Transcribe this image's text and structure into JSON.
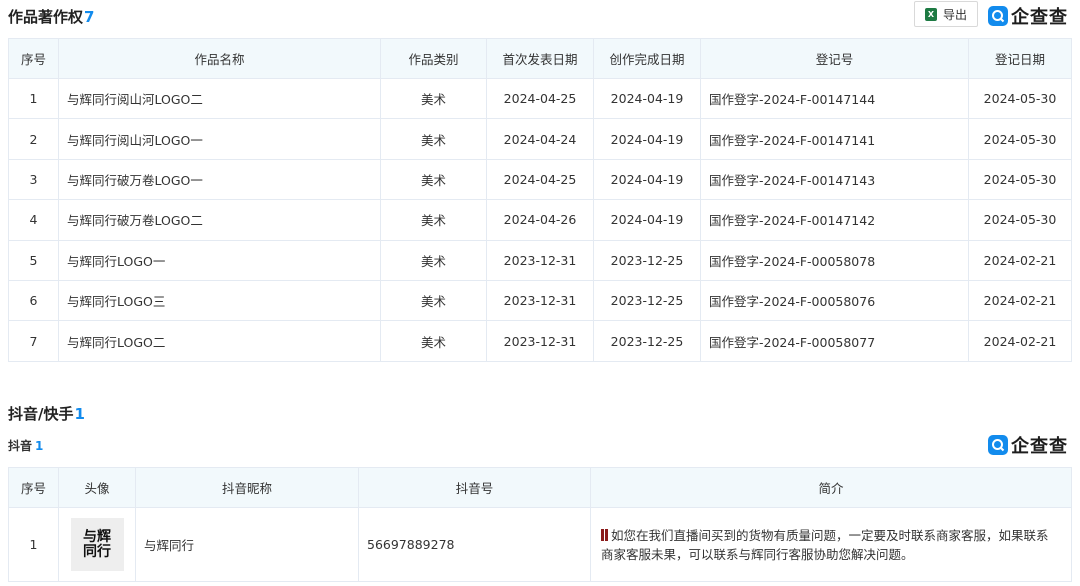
{
  "copyright": {
    "title": "作品著作权",
    "count": "7",
    "export_label": "导出",
    "brand": "企查查",
    "columns": [
      "序号",
      "作品名称",
      "作品类别",
      "首次发表日期",
      "创作完成日期",
      "登记号",
      "登记日期"
    ],
    "rows": [
      [
        "1",
        "与辉同行阅山河LOGO二",
        "美术",
        "2024-04-25",
        "2024-04-19",
        "国作登字-2024-F-00147144",
        "2024-05-30"
      ],
      [
        "2",
        "与辉同行阅山河LOGO一",
        "美术",
        "2024-04-24",
        "2024-04-19",
        "国作登字-2024-F-00147141",
        "2024-05-30"
      ],
      [
        "3",
        "与辉同行破万卷LOGO一",
        "美术",
        "2024-04-25",
        "2024-04-19",
        "国作登字-2024-F-00147143",
        "2024-05-30"
      ],
      [
        "4",
        "与辉同行破万卷LOGO二",
        "美术",
        "2024-04-26",
        "2024-04-19",
        "国作登字-2024-F-00147142",
        "2024-05-30"
      ],
      [
        "5",
        "与辉同行LOGO一",
        "美术",
        "2023-12-31",
        "2023-12-25",
        "国作登字-2024-F-00058078",
        "2024-02-21"
      ],
      [
        "6",
        "与辉同行LOGO三",
        "美术",
        "2023-12-31",
        "2023-12-25",
        "国作登字-2024-F-00058076",
        "2024-02-21"
      ],
      [
        "7",
        "与辉同行LOGO二",
        "美术",
        "2023-12-31",
        "2023-12-25",
        "国作登字-2024-F-00058077",
        "2024-02-21"
      ]
    ]
  },
  "douyin_kuaishou": {
    "title": "抖音/快手",
    "count": "1",
    "sub_title": "抖音",
    "sub_count": "1",
    "brand": "企查查",
    "columns": [
      "序号",
      "头像",
      "抖音昵称",
      "抖音号",
      "简介"
    ],
    "rows": [
      {
        "index": "1",
        "avatar_text": [
          "与",
          "辉",
          "同",
          "行"
        ],
        "nickname": "与辉同行",
        "douyin_id": "56697889278",
        "intro": "如您在我们直播间买到的货物有质量问题，一定要及时联系商家客服，如果联系商家客服未果，可以联系与辉同行客服协助您解决问题。"
      }
    ]
  },
  "colors": {
    "accent": "#128bed",
    "header_bg": "#f2f9fc",
    "border": "#e4eaf2",
    "excel": "#1d7a43"
  }
}
